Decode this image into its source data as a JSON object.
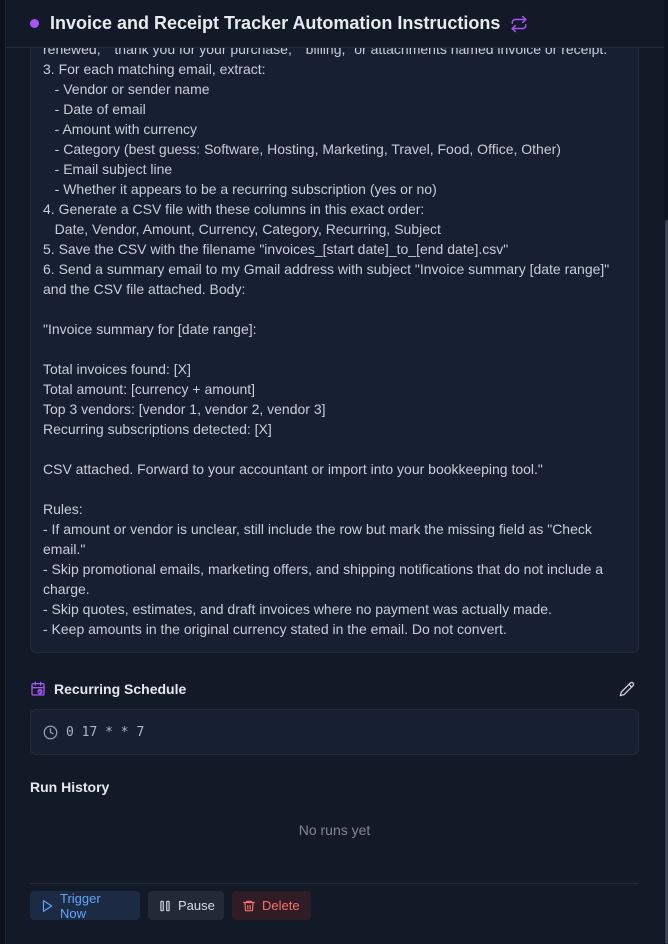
{
  "header": {
    "title": "Invoice and Receipt Tracker Automation Instructions",
    "status_color": "#a855f7",
    "icon": "repeat-icon"
  },
  "instructions": {
    "lines": [
      "renewed,\" \"thank you for your purchase,\" \"billing,\" or attachments named invoice or receipt.",
      "3. For each matching email, extract:",
      "   - Vendor or sender name",
      "   - Date of email",
      "   - Amount with currency",
      "   - Category (best guess: Software, Hosting, Marketing, Travel, Food, Office, Other)",
      "   - Email subject line",
      "   - Whether it appears to be a recurring subscription (yes or no)",
      "4. Generate a CSV file with these columns in this exact order:",
      "   Date, Vendor, Amount, Currency, Category, Recurring, Subject",
      "5. Save the CSV with the filename \"invoices_[start date]_to_[end date].csv\"",
      "6. Send a summary email to my Gmail address with subject \"Invoice summary [date range]\"",
      "and the CSV file attached. Body:",
      "",
      "\"Invoice summary for [date range]:",
      "",
      "Total invoices found: [X]",
      "Total amount: [currency + amount]",
      "Top 3 vendors: [vendor 1, vendor 2, vendor 3]",
      "Recurring subscriptions detected: [X]",
      "",
      "CSV attached. Forward to your accountant or import into your bookkeeping tool.\"",
      "",
      "Rules:",
      "- If amount or vendor is unclear, still include the row but mark the missing field as \"Check",
      "email.\"",
      "- Skip promotional emails, marketing offers, and shipping notifications that do not include a",
      "charge.",
      "- Skip quotes, estimates, and draft invoices where no payment was actually made.",
      "- Keep amounts in the original currency stated in the email. Do not convert."
    ]
  },
  "schedule": {
    "label": "Recurring Schedule",
    "cron": "0 17 * * 7",
    "icon": "calendar-clock-icon",
    "edit_icon": "pencil-icon"
  },
  "history": {
    "title": "Run History",
    "empty_text": "No runs yet"
  },
  "actions": {
    "trigger_label": "Trigger Now",
    "pause_label": "Pause",
    "delete_label": "Delete",
    "trigger_color": "#60a5fa",
    "delete_color": "#f87171"
  }
}
